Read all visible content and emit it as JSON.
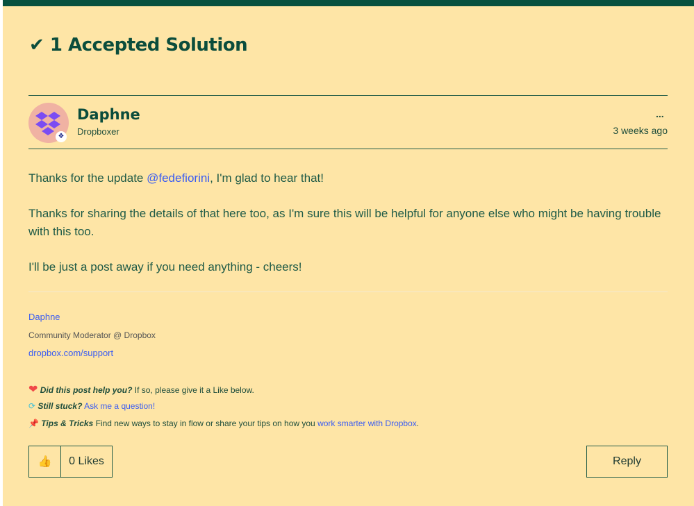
{
  "header": {
    "title": "1 Accepted Solution"
  },
  "post": {
    "author": "Daphne",
    "rank": "Dropboxer",
    "time": "3 weeks ago",
    "more": "...",
    "p1_a": "Thanks for the update ",
    "mention": "@fedefiorini",
    "p1_b": ", I'm glad to hear that!",
    "p2": "Thanks for sharing the details of that here too, as I'm sure this will be helpful for anyone else who might be having trouble with this too.",
    "p3": "I'll be just a post away if you need anything - cheers!"
  },
  "signature": {
    "name": "Daphne",
    "role": "Community Moderator @ Dropbox",
    "link": "dropbox.com/support",
    "help_q": "Did this post help you?",
    "help_t": " If so, please give it a Like below.",
    "stuck_q": "Still stuck?",
    "stuck_link": "Ask me a question!",
    "tips_q": "Tips & Tricks",
    "tips_t": " Find new ways to stay in flow or share your tips on how you ",
    "tips_link": "work smarter with Dropbox",
    "tips_end": "."
  },
  "actions": {
    "likes": "0 Likes",
    "reply": "Reply"
  }
}
